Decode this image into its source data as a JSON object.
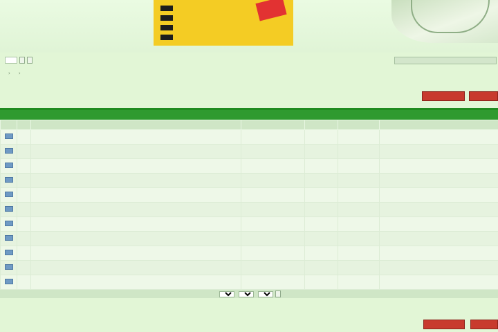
{
  "header": {
    "logo": "",
    "tagline": "",
    "phone": "",
    "email": "",
    "promo_items": [
      "",
      "",
      "",
      ""
    ],
    "promo_tag": "",
    "nav": [
      "",
      "",
      "",
      "",
      ""
    ],
    "search_label": "",
    "search_button": "",
    "advanced_button": "",
    "right_link": ""
  },
  "breadcrumb": [
    "",
    "",
    ""
  ],
  "actions": {
    "new_topic": "",
    "reply": ""
  },
  "forum": {
    "title": "",
    "columns": {
      "topic": "",
      "author": "",
      "replies": "",
      "views": "",
      "last_post": ""
    },
    "topics": [
      {
        "title": "",
        "subtitle": "",
        "author": "",
        "replies": "",
        "views": "",
        "last_date": "",
        "last_author": ""
      },
      {
        "title": "",
        "subtitle": "",
        "author": "",
        "replies": "",
        "views": "",
        "last_date": "",
        "last_author": ""
      },
      {
        "title": "",
        "subtitle": "",
        "author": "",
        "replies": "",
        "views": "",
        "last_date": "",
        "last_author": ""
      },
      {
        "title": "",
        "subtitle": "",
        "author": "",
        "replies": "",
        "views": "",
        "last_date": "",
        "last_author": ""
      },
      {
        "title": "",
        "subtitle": "",
        "author": "",
        "replies": "",
        "views": "",
        "last_date": "",
        "last_author": ""
      },
      {
        "title": "",
        "subtitle": "",
        "author": "",
        "replies": "",
        "views": "",
        "last_date": "",
        "last_author": ""
      },
      {
        "title": "",
        "subtitle": "",
        "author": "",
        "replies": "",
        "views": "",
        "last_date": "",
        "last_author": ""
      },
      {
        "title": "",
        "subtitle": "",
        "author": "",
        "replies": "",
        "views": "",
        "last_date": "",
        "last_author": ""
      },
      {
        "title": "",
        "subtitle": "",
        "author": "",
        "replies": "",
        "views": "",
        "last_date": "",
        "last_author": ""
      },
      {
        "title": "",
        "subtitle": "",
        "author": "",
        "replies": "",
        "views": "",
        "last_date": "",
        "last_author": ""
      },
      {
        "title": "",
        "subtitle": "",
        "author": "",
        "replies": "",
        "views": "",
        "last_date": "",
        "last_author": ""
      }
    ],
    "filter": {
      "label": "",
      "sort_by": "",
      "sort_order": "",
      "period": "",
      "go_button": ""
    }
  },
  "colors": {
    "accent_green": "#2f9a2f",
    "promo_yellow": "#f4cc24",
    "button_red": "#c83a2e",
    "background": "#e2f6d6"
  },
  "icons": [
    "topic-icon",
    "map-icon"
  ]
}
